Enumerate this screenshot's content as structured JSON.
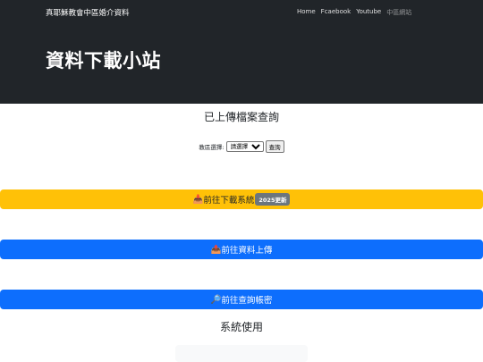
{
  "header": {
    "brand": "真耶穌教會中區婚介資料",
    "nav": [
      "Home",
      "Fcaebook",
      "Youtube",
      "中區網站"
    ],
    "title": "資料下載小站"
  },
  "query": {
    "section_title": "已上傳檔案查詢",
    "label": "教區選擇:",
    "select_value": "請選擇",
    "button": "查詢"
  },
  "actions": {
    "download": {
      "icon": "📥",
      "label": "前往下載系統",
      "badge": "2025更新"
    },
    "upload": {
      "icon": "📤",
      "label": "前往資料上傳"
    },
    "password": {
      "icon": "🔎",
      "label": "前往查詢帳密"
    }
  },
  "system_title": "系統使用",
  "colors": {
    "dark": "#212529",
    "warning": "#ffc107",
    "primary": "#0d6efd",
    "badge": "#6c757d"
  }
}
